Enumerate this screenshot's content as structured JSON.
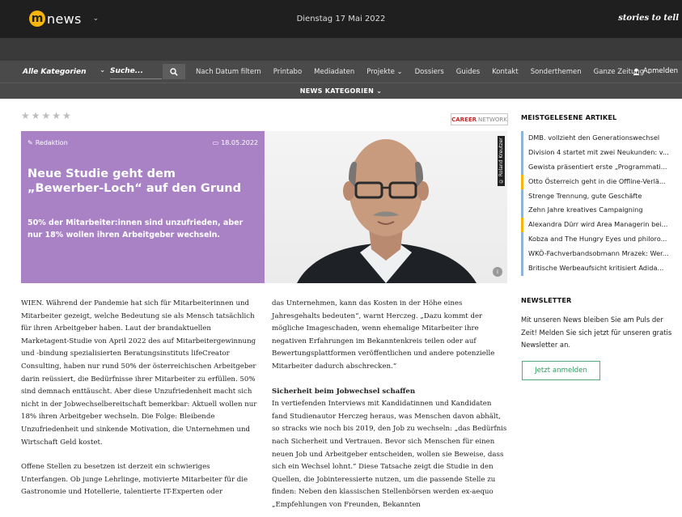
{
  "header": {
    "logo_letter": "m",
    "logo_text": "news",
    "date": "Dienstag 17 Mai 2022",
    "tagline": "stories to tell"
  },
  "nav": {
    "category_select": "Alle Kategorien",
    "search_placeholder": "Suche...",
    "links": [
      "Nach Datum filtern",
      "Printabo",
      "Mediadaten",
      "Projekte ⌄",
      "Dossiers",
      "Guides",
      "Kontakt",
      "Sonderthemen",
      "Ganze Zeitung ⌄"
    ],
    "login": "Anmelden",
    "category_bar": "NEWS KATEGORIEN ⌄"
  },
  "article": {
    "rating_stars": "★★★★★",
    "career_badge_bold": "CAREER",
    "career_badge_rest": "NETWORK",
    "author": "Redaktion",
    "date": "18.05.2022",
    "title": "Neue Studie geht dem „Bewerber-Loch“ auf den Grund",
    "subtitle": "50% der Mitarbeiter:innen sind unzufrieden, aber nur 18% wollen ihren Arbeitgeber wechseln.",
    "photo_credit": "© Roland Kreutzer",
    "info_badge": "i",
    "col_left": [
      "WIEN. Während der Pandemie hat sich für Mitarbeiterinnen und Mitarbeiter gezeigt, welche Bedeutung sie als Mensch tatsächlich für ihren Arbeitgeber haben. Laut der brandaktuellen Marketagent-Studie von April 2022 des auf Mitarbeitergewinnung und -bindung spezialisierten Beratungsinstituts lifeCreator Consulting, haben nur rund 50% der österreichischen Arbeitgeber darin reüssiert, die Bedürfnisse ihrer Mitarbeiter zu erfüllen. 50% sind demnach enttäuscht. Aber diese Unzufriedenheit macht sich nicht in der Jobwechselbereitschaft bemerkbar: Aktuell wollen nur 18% ihren Arbeitgeber wechseln. Die Folge: Bleibende Unzufriedenheit und sinkende Motivation, die Unternehmen und Wirtschaft Geld kostet.",
      "Offene Stellen zu besetzen ist derzeit ein schwieriges Unterfangen. Ob junge Lehrlinge, motivierte Mitarbeiter für die Gastronomie und Hotellerie, talentierte IT-Experten oder"
    ],
    "col_right_p1": "das Unternehmen, kann das Kosten in der Höhe eines Jahresgehalts bedeuten“, warnt Herczeg. „Dazu kommt der mögliche Imageschaden, wenn ehemalige Mitarbeiter ihre negativen Erfahrungen im Bekanntenkreis teilen oder auf Bewertungsplattformen veröffentlichen und andere potenzielle Mitarbeiter dadurch abschrecken.“",
    "col_right_heading": "Sicherheit beim Jobwechsel schaffen",
    "col_right_p2": "In vertiefenden Interviews mit Kandidatinnen und Kandidaten fand Studienautor Herczeg heraus, was Menschen davon abhält, so stracks wie noch bis 2019, den Job zu wechseln: „das Bedürfnis nach Sicherheit und Vertrauen. Bevor sich Menschen für einen neuen Job und Arbeitgeber entscheiden, wollen sie Beweise, dass sich ein Wechsel lohnt.“ Diese Tatsache zeigt die Studie in den Quellen, die Jobinteressierte nutzen, um die passende Stelle zu finden: Neben den klassischen Stellenbörsen werden ex-aequo „Empfehlungen von Freunden, Bekannten"
  },
  "sidebar": {
    "most_read_heading": "MEISTGELESENE ARTIKEL",
    "most_read": [
      "DMB. vollzieht den Generationswechsel",
      "Division 4 startet mit zwei Neukunden: v...",
      "Gewista präsentiert erste „Programmati...",
      "Otto Österreich geht in die Offline-Verlä...",
      "Strenge Trennung, gute Geschäfte",
      "Zehn Jahre kreatives Campaigning",
      "Alexandra Dürr wird Area Managerin bei...",
      "Kobza and The Hungry Eyes und philoro...",
      "WKÖ-Fachverbandsobmann Mrazek: Wer...",
      "Britische Werbeaufsicht kritisiert Adida..."
    ],
    "newsletter_heading": "NEWSLETTER",
    "newsletter_text": "Mit unseren News bleiben Sie am Puls der Zeit! Melden Sie sich jetzt für unseren gratis Newsletter an.",
    "subscribe_label": "Jetzt anmelden"
  },
  "colors": {
    "hero_purple": "#a882c5",
    "accent_gold": "#f5b50a",
    "list_blue": "#8fb3d9",
    "subscribe_green": "#2f9b5f"
  }
}
